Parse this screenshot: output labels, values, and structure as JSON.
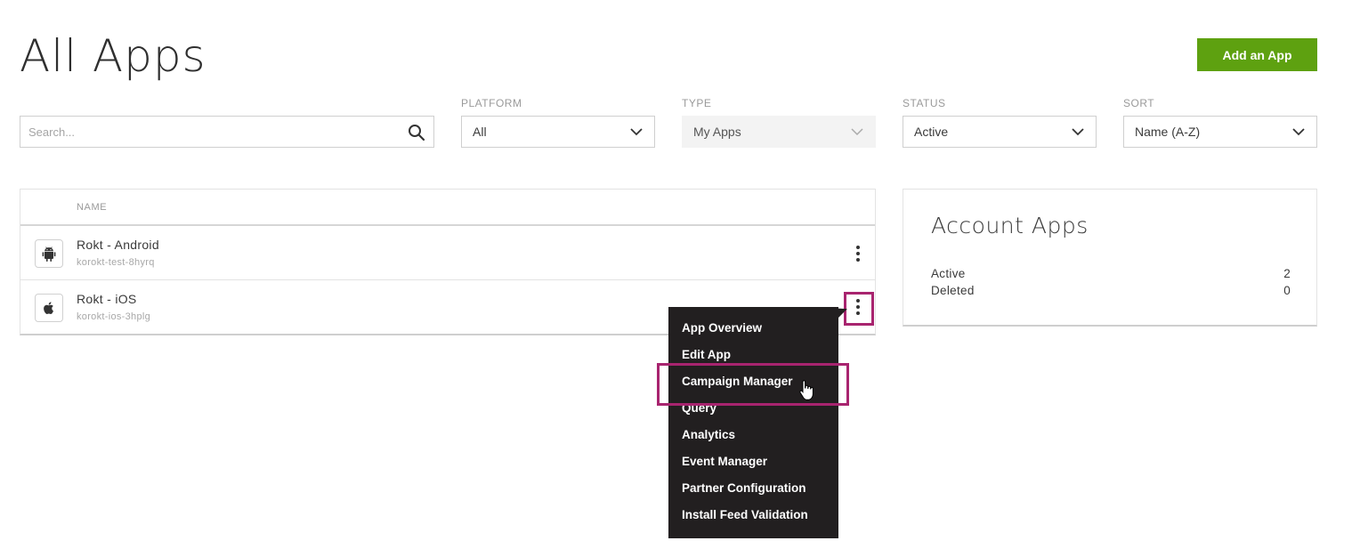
{
  "header": {
    "title": "All Apps",
    "add_button": "Add an App"
  },
  "filters": {
    "search_placeholder": "Search...",
    "platform": {
      "label": "PLATFORM",
      "value": "All"
    },
    "type": {
      "label": "TYPE",
      "value": "My Apps"
    },
    "status": {
      "label": "STATUS",
      "value": "Active"
    },
    "sort": {
      "label": "SORT",
      "value": "Name (A-Z)"
    }
  },
  "table": {
    "column_name": "NAME",
    "rows": [
      {
        "name": "Rokt - Android",
        "id": "korokt-test-8hyrq",
        "icon": "android-icon"
      },
      {
        "name": "Rokt - iOS",
        "id": "korokt-ios-3hplg",
        "icon": "apple-icon"
      }
    ]
  },
  "context_menu": {
    "items": [
      "App Overview",
      "Edit App",
      "Campaign Manager",
      "Query",
      "Analytics",
      "Event Manager",
      "Partner Configuration",
      "Install Feed Validation"
    ],
    "highlight_color": "#a8246f"
  },
  "account_apps": {
    "title": "Account Apps",
    "stats": [
      {
        "label": "Active",
        "value": "2"
      },
      {
        "label": "Deleted",
        "value": "0"
      }
    ]
  },
  "colors": {
    "accent": "#5ea110",
    "menu_bg": "#221f20"
  }
}
